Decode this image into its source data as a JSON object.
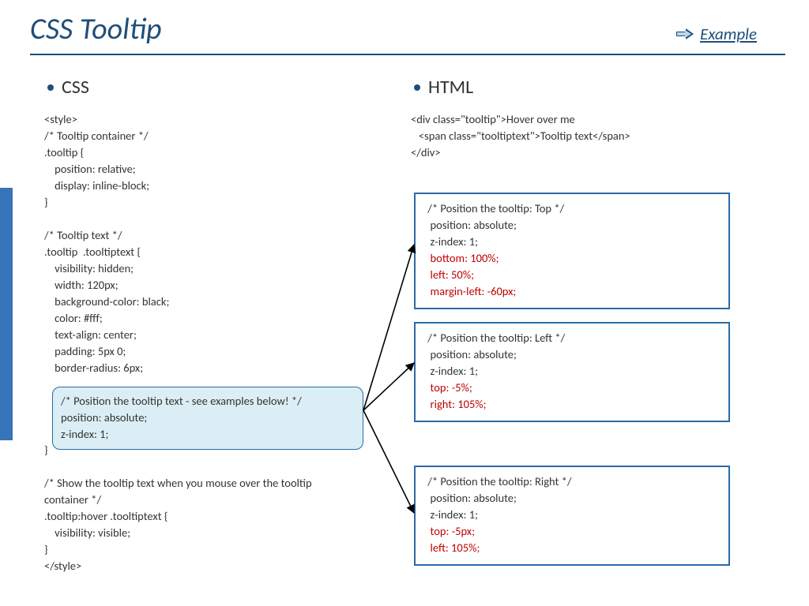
{
  "title": "CSS Tooltip",
  "example_link": "Example",
  "left": {
    "heading": "CSS",
    "code_above": "<style>\n/* Tooltip container */\n.tooltip {\n    position: relative;\n    display: inline-block;\n}\n\n/* Tooltip text */\n.tooltip  .tooltiptext {\n    visibility: hidden;\n    width: 120px;\n    background-color: black;\n    color: #fff;\n    text-align: center;\n    padding: 5px 0;\n    border-radius: 6px;\n",
    "callout": "/* Position the tooltip text - see examples below! */\nposition: absolute;\nz-index: 1;",
    "code_below": "}\n\n/* Show the tooltip text when you mouse over the tooltip\ncontainer */\n.tooltip:hover .tooltiptext {\n    visibility: visible;\n}\n</style>"
  },
  "right": {
    "heading": "HTML",
    "code": "<div class=\"tooltip\">Hover over me\n   <span class=\"tooltiptext\">Tooltip text</span>\n</div>"
  },
  "boxes": {
    "top": {
      "l1": " /* Position the tooltip: Top */",
      "l2": "  position: absolute;",
      "l3": "  z-index: 1;",
      "l4": "  bottom: 100%;",
      "l5": "  left: 50%;",
      "l6": "  margin-left: -60px;"
    },
    "left": {
      "l1": " /* Position the tooltip: Left */",
      "l2": "  position: absolute;",
      "l3": "  z-index: 1;",
      "l4": "  top: -5%;",
      "l5": "  right: 105%;"
    },
    "right": {
      "l1": " /* Position the tooltip: Right */",
      "l2": "  position: absolute;",
      "l3": "  z-index: 1;",
      "l4": "  top: -5px;",
      "l5": "  left: 105%;"
    }
  }
}
